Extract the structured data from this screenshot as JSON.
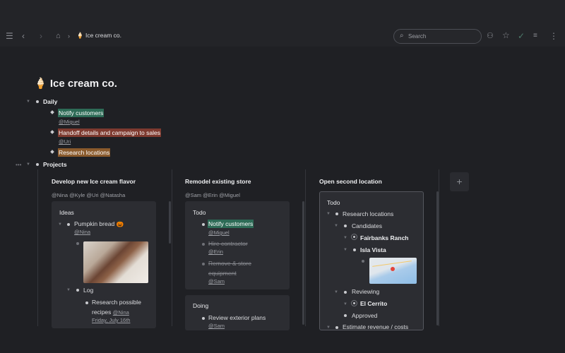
{
  "topbar": {
    "breadcrumb_emoji": "🍦",
    "breadcrumb": "Ice cream co.",
    "search_placeholder": "Search"
  },
  "page": {
    "emoji": "🍦",
    "title": "Ice cream co."
  },
  "daily": {
    "label": "Daily",
    "items": [
      {
        "text": "Notify customers",
        "mention": "@Miguel",
        "highlight": "#2d6b56"
      },
      {
        "text": "Handoff details and campaign to sales",
        "mention": "@Uri",
        "highlight": "#7e3a2f"
      },
      {
        "text": "Research locations",
        "highlight": "#8a5a2c"
      }
    ]
  },
  "projects": {
    "label": "Projects",
    "columns": [
      {
        "title": "Develop new Ice cream flavor",
        "people": "@Nina @Kyle @Uri @Natasha",
        "card": {
          "title": "Ideas",
          "pumpkin": "Pumpkin bread 🎃",
          "pumpkin_mention": "@Nina",
          "log": "Log",
          "research_1": "Research possible",
          "research_2": "recipes",
          "research_mention": "@Nina",
          "research_date": "Friday, July 16th"
        }
      },
      {
        "title": "Remodel existing store",
        "people": "@Sam @Erin @Miguel",
        "todo": {
          "title": "Todo",
          "notify": "Notify customers",
          "notify_mention": "@Miguel",
          "hire": "Hire contractor",
          "hire_mention": "@Erin",
          "remove_1": "Remove & store",
          "remove_2": "equipment",
          "remove_mention": "@Sam"
        },
        "doing": {
          "title": "Doing",
          "review": "Review exterior plans",
          "review_mention": "@Sam"
        }
      },
      {
        "title": "Open second location",
        "card": {
          "title": "Todo",
          "research": "Research locations",
          "candidates": "Candidates",
          "fairbanks": "Fairbanks Ranch",
          "isla": "Isla Vista",
          "reviewing": "Reviewing",
          "el_cerrito": "El Cerrito",
          "approved": "Approved",
          "estimate": "Estimate revenue / costs"
        }
      }
    ],
    "add_column": "+"
  },
  "colors": {
    "background": "#1f2024",
    "card": "#2c2d32",
    "accent_green": "#2d6b56",
    "accent_red": "#7e3a2f",
    "accent_orange": "#8a5a2c"
  }
}
